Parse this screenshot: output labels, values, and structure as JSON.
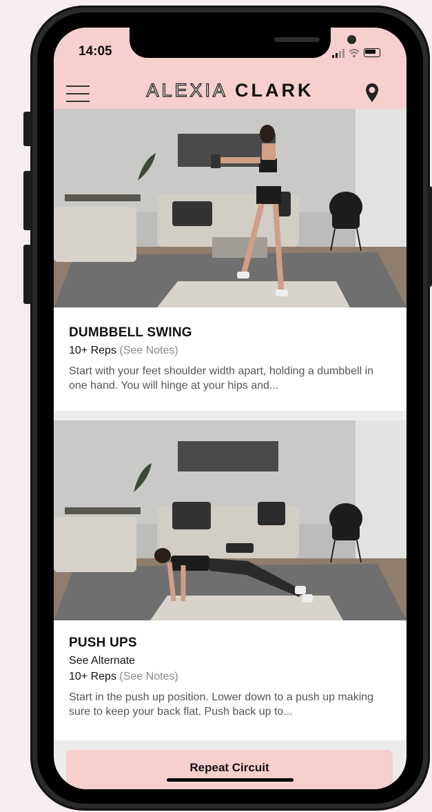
{
  "status_bar": {
    "time": "14:05"
  },
  "header": {
    "brand_light": "ALEXIA",
    "brand_bold": "CLARK"
  },
  "icons": {
    "menu": "hamburger-menu-icon",
    "location": "location-pin-icon"
  },
  "exercises": [
    {
      "title": "DUMBBELL SWING",
      "alternate": null,
      "reps": "10+ Reps",
      "notes": "(See Notes)",
      "description": "Start with your feet shoulder width apart, holding a dumbbell in one hand. You will hinge at your hips and..."
    },
    {
      "title": "PUSH UPS",
      "alternate": "See Alternate",
      "reps": "10+ Reps",
      "notes": "(See Notes)",
      "description": "Start in the push up position. Lower down to a push up making sure to keep your back flat. Push back up to..."
    }
  ],
  "actions": {
    "repeat_label": "Repeat Circuit"
  },
  "colors": {
    "accent_pink": "#f7cfcf",
    "background": "#f6eeee"
  }
}
